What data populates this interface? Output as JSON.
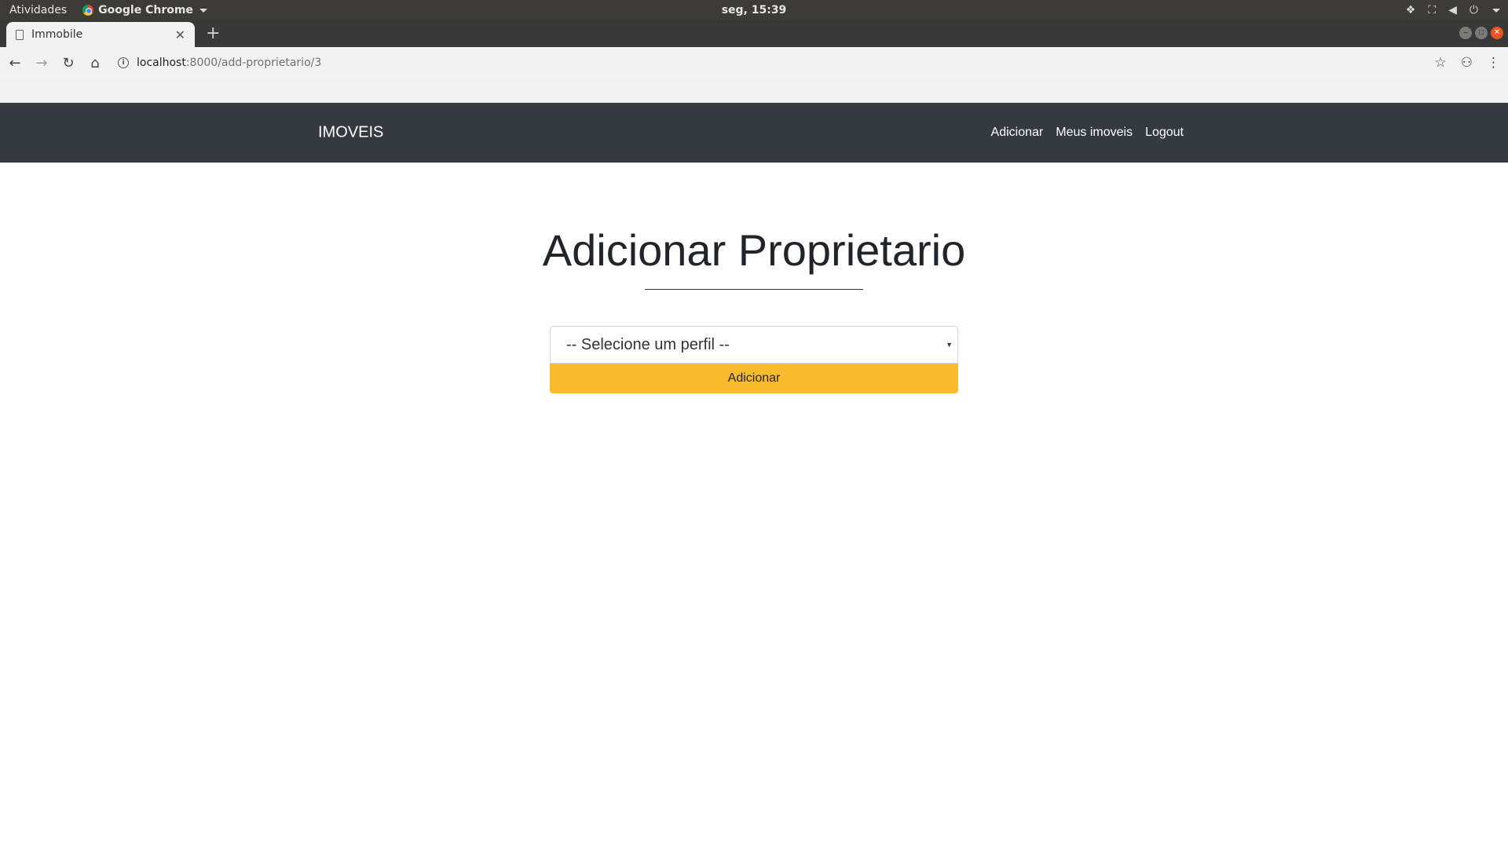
{
  "os_bar": {
    "activities": "Atividades",
    "app_name": "Google Chrome",
    "clock": "seg, 15:39"
  },
  "browser": {
    "tab_title": "Immobile",
    "url_host": "localhost",
    "url_path": ":8000/add-proprietario/3"
  },
  "navbar": {
    "brand": "IMOVEIS",
    "links": [
      {
        "label": "Adicionar"
      },
      {
        "label": "Meus imoveis"
      },
      {
        "label": "Logout"
      }
    ]
  },
  "main": {
    "title": "Adicionar Proprietario",
    "select_placeholder": "-- Selecione um perfil --",
    "submit_label": "Adicionar"
  },
  "colors": {
    "navbar_bg": "#343a40",
    "button_accent": "#fbbb2f",
    "os_bar_bg": "#3c3b37"
  },
  "icons": [
    "chrome-logo-icon",
    "page-icon",
    "close-icon",
    "plus-icon",
    "back-icon",
    "forward-icon",
    "reload-icon",
    "home-icon",
    "info-icon",
    "star-icon",
    "extension-icon",
    "menu-icon",
    "network-icon",
    "volume-icon",
    "power-icon"
  ]
}
